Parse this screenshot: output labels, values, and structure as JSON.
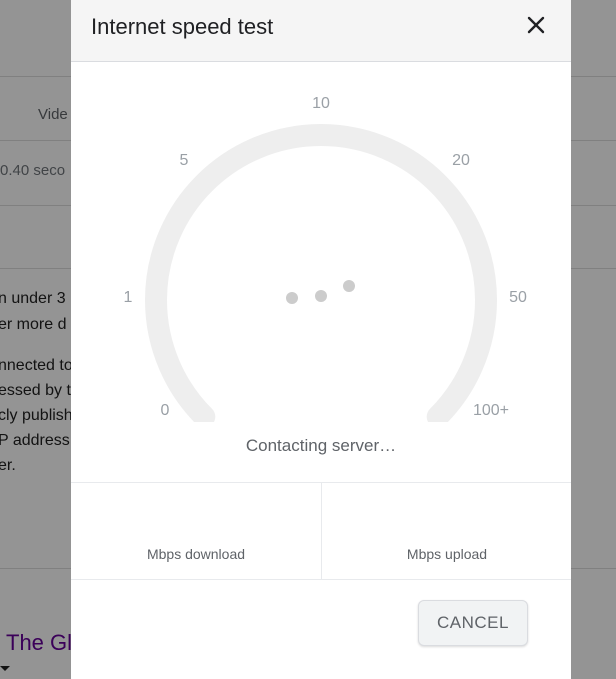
{
  "background": {
    "tab_fragment": "Vide",
    "stats_fragment": "0.40 seco",
    "text_fragments": [
      "n under 3",
      "er more d",
      "nnected to",
      "essed by t",
      "cly publish",
      "P address",
      "er."
    ],
    "link_fragment": "The Gl"
  },
  "dialog": {
    "title": "Internet speed test",
    "close_icon": "close-icon",
    "gauge": {
      "tick_labels": [
        "0",
        "1",
        "5",
        "10",
        "20",
        "50",
        "100+"
      ],
      "track_color": "#eeeeee",
      "loading_dots_color": "#cccccc"
    },
    "status": "Contacting server…",
    "download_label": "Mbps download",
    "upload_label": "Mbps upload",
    "cancel_label": "CANCEL"
  }
}
